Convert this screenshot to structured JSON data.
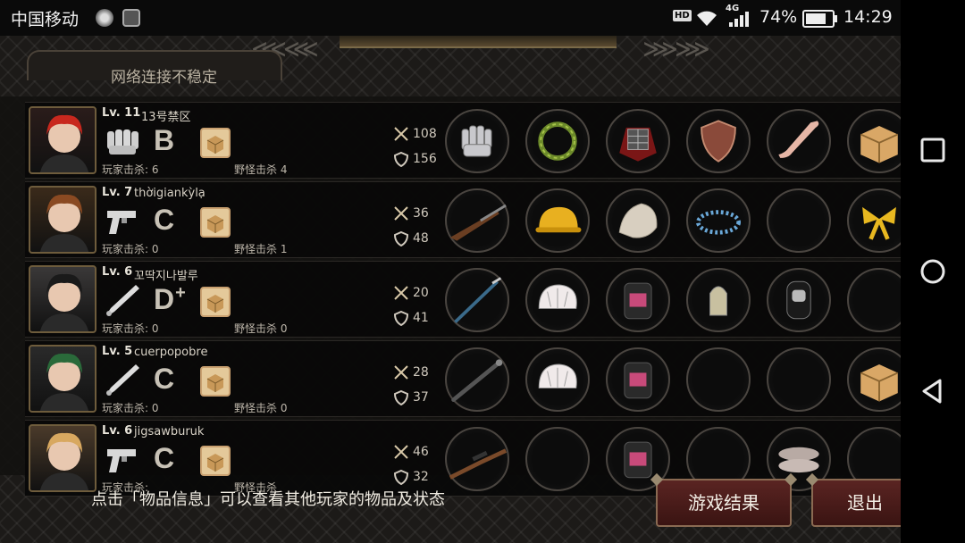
{
  "status_bar": {
    "carrier": "中国移动",
    "hd": "HD",
    "network": "4G",
    "battery": "74%",
    "time": "14:29",
    "icons": [
      "notification-icon-1",
      "gallery-icon",
      "wifi-icon",
      "signal-icon",
      "battery-icon"
    ]
  },
  "header": {
    "tab_text": "网络连接不稳定"
  },
  "players": [
    {
      "level": "Lv. 11",
      "name": "13号禁区",
      "weapon_icon": "fist-icon",
      "grade": "B",
      "grade_sup": "",
      "player_kills_label": "玩家击杀",
      "player_kills": "6",
      "monster_kills_label": "野怪击杀",
      "monster_kills": "4",
      "attack": "108",
      "defense": "156",
      "items": [
        "gauntlet-icon",
        "laurel-wreath-icon",
        "armor-icon",
        "shield-icon",
        "leg-icon",
        "cardboard-box-icon"
      ]
    },
    {
      "level": "Lv. 7",
      "name": "thờigiankỳlạ",
      "weapon_icon": "pistol-icon",
      "grade": "C",
      "grade_sup": "",
      "player_kills_label": "玩家击杀",
      "player_kills": "0",
      "monster_kills_label": "野怪击杀",
      "monster_kills": "1",
      "attack": "36",
      "defense": "48",
      "items": [
        "musket-icon",
        "hard-hat-icon",
        "cloth-icon",
        "bead-bracelet-icon",
        "empty",
        "gift-bow-icon"
      ]
    },
    {
      "level": "Lv. 6",
      "name": "꼬딱지나발루",
      "weapon_icon": "baseball-bat-icon",
      "grade": "D",
      "grade_sup": "+",
      "player_kills_label": "玩家击杀",
      "player_kills": "0",
      "monster_kills_label": "野怪击杀",
      "monster_kills": "0",
      "attack": "20",
      "defense": "41",
      "items": [
        "rod-icon",
        "bike-helmet-icon",
        "backpack-icon",
        "bullet-icon",
        "knee-pad-icon",
        "empty"
      ]
    },
    {
      "level": "Lv. 5",
      "name": "cuerpopobre",
      "weapon_icon": "baseball-bat-icon",
      "grade": "C",
      "grade_sup": "",
      "player_kills_label": "玩家击杀",
      "player_kills": "0",
      "monster_kills_label": "野怪击杀",
      "monster_kills": "0",
      "attack": "28",
      "defense": "37",
      "items": [
        "pipe-icon",
        "bike-helmet-icon",
        "backpack-icon",
        "empty",
        "empty",
        "cardboard-box-icon"
      ]
    },
    {
      "level": "Lv. 6",
      "name": "jigsawburuk",
      "weapon_icon": "pistol-icon",
      "grade": "C",
      "grade_sup": "",
      "player_kills_label": "玩家击杀",
      "player_kills": "",
      "monster_kills_label": "野怪击杀",
      "monster_kills": "",
      "attack": "46",
      "defense": "32",
      "items": [
        "sniper-rifle-icon",
        "empty",
        "backpack-icon",
        "empty",
        "slippers-icon",
        "empty"
      ]
    }
  ],
  "footer": {
    "hint": "点击「物品信息」可以查看其他玩家的物品及状态",
    "result_button": "游戏结果",
    "exit_button": "退出"
  },
  "colors": {
    "frame": "#6e5c3c",
    "button": "#5a2422",
    "background": "#1c1a18"
  }
}
